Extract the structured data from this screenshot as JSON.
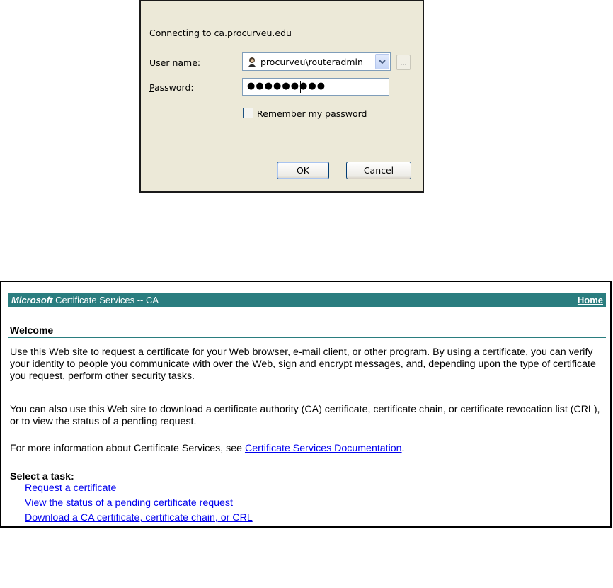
{
  "dialog": {
    "connecting_text": "Connecting to ca.procurveu.edu",
    "user_label_first": "U",
    "user_label_rest": "ser name:",
    "user_value": "procurveu\\routeradmin",
    "browse_label": "...",
    "password_label_first": "P",
    "password_label_rest": "assword:",
    "password_mask": "●●●●●●●●●",
    "remember_label_first": "R",
    "remember_label_rest": "emember my password",
    "remember_checked": false,
    "ok_label": "OK",
    "cancel_label": "Cancel"
  },
  "cert_page": {
    "header_brand_bold": "Microsoft",
    "header_title": " Certificate Services  --  CA",
    "home_link": "Home",
    "welcome_title": "Welcome",
    "para1": "Use this Web site to request a certificate for your Web browser, e-mail client, or other program. By using a certificate, you can verify your identity to people you communicate with over the Web, sign and encrypt messages, and, depending upon the type of certificate you request, perform other security tasks.",
    "para2": "You can also use this Web site to download a certificate authority (CA) certificate, certificate chain, or certificate revocation list (CRL), or to view the status of a pending request.",
    "para3_prefix": "For more information about Certificate Services, see ",
    "para3_link": "Certificate Services Documentation",
    "para3_suffix": ".",
    "select_task": "Select a task:",
    "tasks": [
      "Request a certificate",
      "View the status of a pending certificate request",
      "Download a CA certificate, certificate chain, or CRL"
    ]
  },
  "colors": {
    "header_bg": "#2a7d7f",
    "link": "#0000ee",
    "dialog_bg": "#ece9d8"
  }
}
